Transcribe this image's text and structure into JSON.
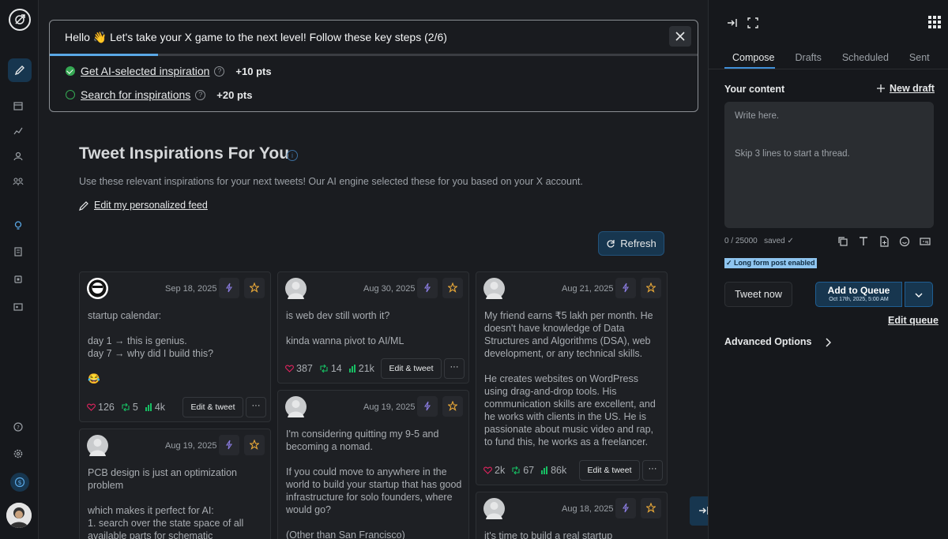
{
  "onboarding": {
    "title": "Hello 👋  Let's take your X game to the next level! Follow these key steps (2/6)",
    "progress": 0.167,
    "steps": [
      {
        "label": "Get AI-selected inspiration",
        "points": "+10 pts",
        "done": true
      },
      {
        "label": "Search for inspirations",
        "points": "+20 pts",
        "done": false
      }
    ]
  },
  "main": {
    "heading": "Tweet Inspirations For You",
    "subtext": "Use these relevant inspirations for your next tweets! Our AI engine selected these for you based on your X account.",
    "edit_feed": "Edit my personalized feed",
    "refresh": "Refresh"
  },
  "cards": [
    {
      "date": "Sep 18, 2025",
      "text": "startup calendar:\n\nday 1 → this is genius.\nday 7 → why did I build this?\n\n😂",
      "likes": "126",
      "retweets": "5",
      "views": "4k",
      "edit": "Edit & tweet",
      "more": "···"
    },
    {
      "date": "Aug 19, 2025",
      "text": "PCB design is just an optimization problem\n\nwhich makes it perfect for AI:\n1. search over the state space of all available parts for schematic"
    },
    {
      "date": "Aug 30, 2025",
      "text": "is web dev still worth it?\n\nkinda wanna pivot to AI/ML",
      "likes": "387",
      "retweets": "14",
      "views": "21k",
      "edit": "Edit & tweet",
      "more": "···"
    },
    {
      "date": "Aug 19, 2025",
      "text": "I'm considering quitting my 9-5 and becoming a nomad.\n\nIf you could move to anywhere in the world to build your startup that has good infrastructure for solo founders, where would go?\n\n(Other than San Francisco)"
    },
    {
      "date": "Aug 21, 2025",
      "text": "My friend earns ₹5 lakh per month. He doesn't have knowledge of Data Structures and Algorithms (DSA), web development, or any technical skills.\n\nHe creates websites on WordPress using drag-and-drop tools. His communication skills are excellent, and he works with clients in the US. He is passionate about music video and rap, to fund this, he works as a freelancer.",
      "likes": "2k",
      "retweets": "67",
      "views": "86k",
      "edit": "Edit & tweet",
      "more": "···"
    },
    {
      "date": "Aug 18, 2025",
      "text": "it's time to build a real startup"
    }
  ],
  "right": {
    "tabs": [
      "Compose",
      "Drafts",
      "Scheduled",
      "Sent"
    ],
    "your_content": "Your content",
    "new_draft": "New draft",
    "placeholder_1": "Write here.",
    "placeholder_2": "Skip 3 lines to start a thread.",
    "count": "0 / 25000",
    "saved": "saved ✓",
    "long_form": "✓ Long form post enabled",
    "tweet_now": "Tweet now",
    "add_queue": "Add to Queue",
    "queue_time": "Oct 17th, 2025, 5:00 AM",
    "edit_queue": "Edit queue",
    "advanced": "Advanced Options"
  },
  "colors": {
    "accent": "#3f8fd8",
    "success": "#35a853",
    "like": "#e0245e",
    "retweet": "#17bf63"
  }
}
